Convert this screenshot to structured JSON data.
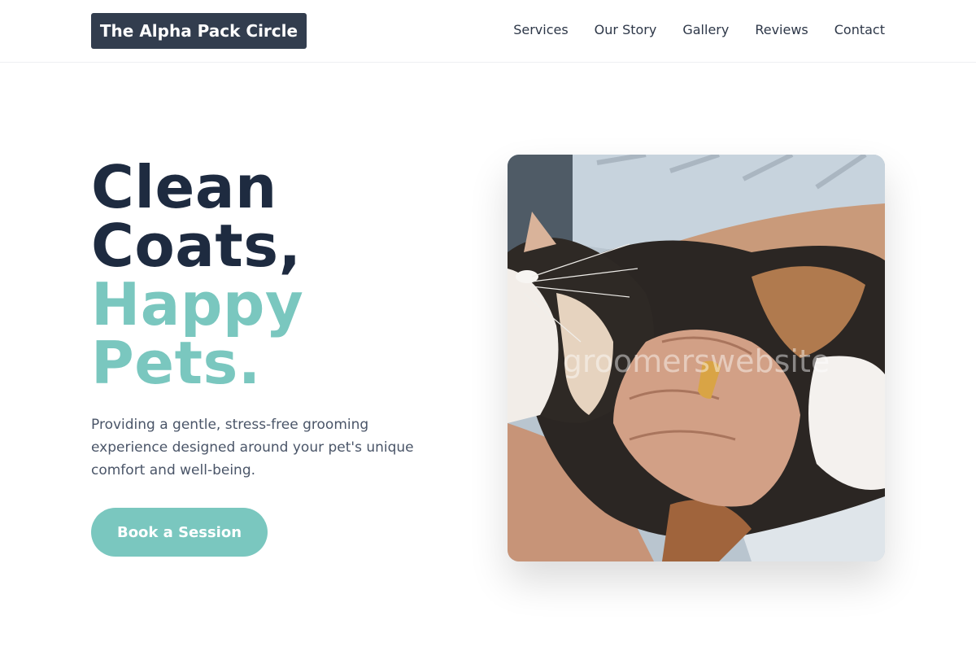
{
  "brand": {
    "name": "The Alpha Pack Circle"
  },
  "nav": {
    "items": [
      {
        "label": "Services"
      },
      {
        "label": "Our Story"
      },
      {
        "label": "Gallery"
      },
      {
        "label": "Reviews"
      },
      {
        "label": "Contact"
      }
    ]
  },
  "hero": {
    "line1": "Clean",
    "line2": "Coats,",
    "line3": "Happy",
    "line4": "Pets.",
    "description": "Providing a gentle, stress-free grooming experience designed around your pet's unique comfort and well-being.",
    "cta_label": "Book a Session",
    "image_watermark": "groomerswebsite"
  },
  "colors": {
    "brand_dark": "#323d4e",
    "heading_dark": "#1e2b40",
    "accent_teal": "#7ac7bf"
  }
}
